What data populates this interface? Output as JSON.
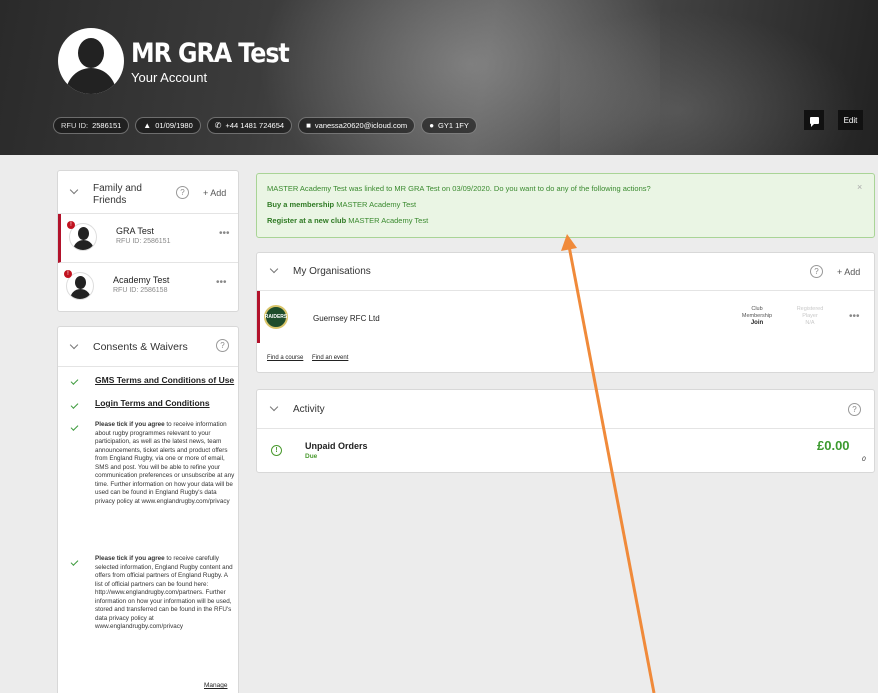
{
  "header": {
    "name": "MR GRA Test",
    "subtitle": "Your Account",
    "rfu_label": "RFU ID:",
    "rfu_id": "2586151",
    "dob": "01/09/1980",
    "phone": "+44 1481 724654",
    "email": "vanessa20620@icloud.com",
    "postcode": "GY1 1FY",
    "edit_label": "Edit"
  },
  "family": {
    "title": "Family and Friends",
    "add_label": "+ Add",
    "members": [
      {
        "name": "GRA Test",
        "rfu": "RFU ID: 2586151"
      },
      {
        "name": "Academy Test",
        "rfu": "RFU ID: 2586158"
      }
    ]
  },
  "consents": {
    "title": "Consents & Waivers",
    "link1": "GMS Terms and Conditions of Use",
    "link2": "Login Terms and Conditions",
    "item3_bold": "Please tick if you agree",
    "item3_text": " to receive information about rugby programmes relevant to your participation, as well as the latest news, team announcements, ticket alerts and product offers from England Rugby, via one or more of email, SMS and post. You will be able to refine your communication preferences or unsubscribe at any time. Further information on how your data will be used can be found in England Rugby's data privacy policy at www.englandrugby.com/privacy",
    "item4_bold": "Please tick if you agree",
    "item4_text": " to receive carefully selected information, England Rugby content and offers from official partners of England Rugby. A list of official partners can be found here: http://www.englandrugby.com/partners. Further information on how your information will be used, stored and transferred can be found in the RFU's data privacy policy at www.englandrugby.com/privacy",
    "manage_label": "Manage"
  },
  "banner": {
    "message": "MASTER Academy Test was linked to MR GRA Test on 03/09/2020. Do you want to do any of the following actions?",
    "action1_bold": "Buy a membership",
    "action1_text": " MASTER Academy Test",
    "action2_bold": "Register at a new club",
    "action2_text": " MASTER Academy Test",
    "close": "×"
  },
  "organisations": {
    "title": "My Organisations",
    "add_label": "+ Add",
    "club_name": "Guernsey RFC Ltd",
    "club_logo_text": "RAIDERS",
    "membership_label1": "Club",
    "membership_label2": "Membership",
    "membership_action": "Join",
    "registered_label1": "Registered",
    "registered_label2": "Player",
    "registered_value": "N/A",
    "find_course": "Find a course",
    "find_event": "Find an event"
  },
  "activity": {
    "title": "Activity",
    "unpaid_label": "Unpaid Orders",
    "due_label": "Due",
    "amount": "£0.00",
    "count": "0"
  },
  "colors": {
    "accent_red": "#b2122b",
    "success_green": "#3c9a2f",
    "annotation_arrow": "#f08a3a"
  }
}
